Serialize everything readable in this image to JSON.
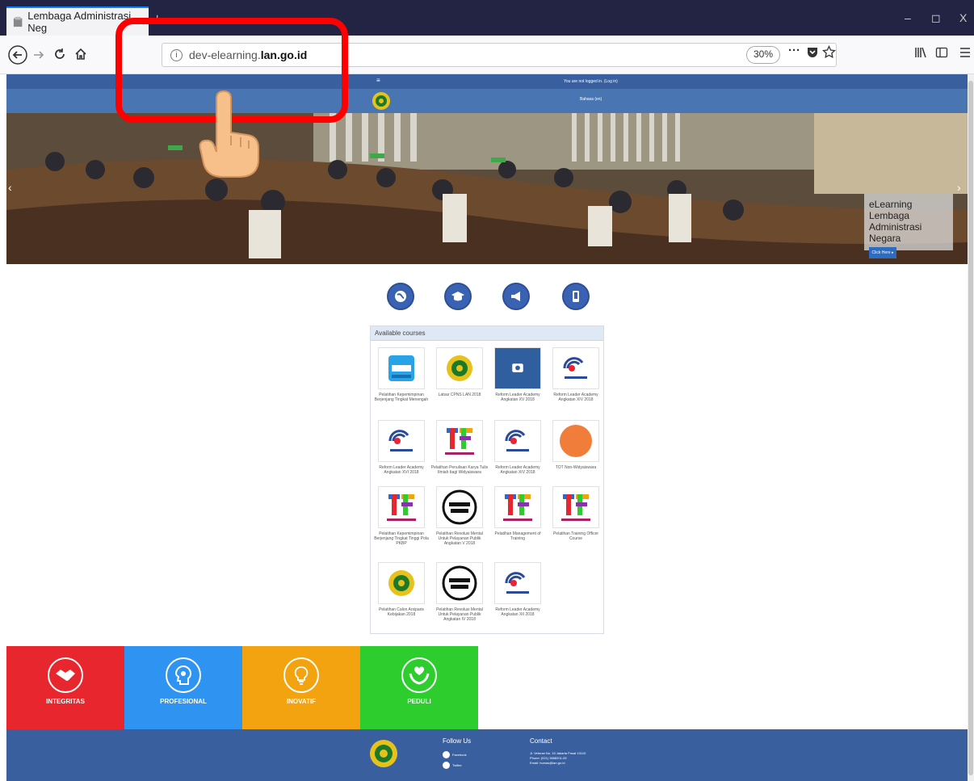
{
  "browser": {
    "tab_title": "Lembaga Administrasi Neg",
    "tab_close": "×",
    "new_tab": "+",
    "url_prefix": "dev-elearning.",
    "url_domain": "lan.go.id",
    "zoom": "30%",
    "window": {
      "minimize": "–",
      "restore": "◻",
      "close": "X"
    }
  },
  "site": {
    "topbar_menu": "≡",
    "topbar_text": "You are not logged in. (Log in)",
    "subbar_text": "Bahasa (en)",
    "hero": {
      "caption": "eLearning Lembaga Administrasi Negara",
      "caption_button": "Click Here ▸",
      "prev": "‹",
      "next": "›"
    },
    "courses": {
      "header": "Available courses",
      "items": [
        {
          "name": "Pelatihan Kepemimpinan Berjenjang Tingkat Menengah",
          "logo": "tab-app"
        },
        {
          "name": "Latsar CPNS LAN 2018",
          "logo": "garuda"
        },
        {
          "name": "Reform Leader Academy Angkatan XV 2018",
          "logo": "camera"
        },
        {
          "name": "Reform Leader Academy Angkatan XIV 2018",
          "logo": "rla"
        },
        {
          "name": "Reform Leader Academy Angkatan XVI 2018",
          "logo": "rla"
        },
        {
          "name": "Pelatihan Penulisan Karya Tulis Ilmiah bagi Widyaiswara",
          "logo": "tf"
        },
        {
          "name": "Reform Leader Academy Angkatan XIV 2018",
          "logo": "rla"
        },
        {
          "name": "TOT Non-Widyaiswara",
          "logo": "tot"
        },
        {
          "name": "Pelatihan Kepemimpinan Berjenjang Tingkat Tinggi Pola PKBP",
          "logo": "tf"
        },
        {
          "name": "Pelatihan Revolusi Mental Untuk Pelayanan Publik Angkatan V 2018",
          "logo": "revolusi"
        },
        {
          "name": "Pelatihan Management of Training",
          "logo": "tf"
        },
        {
          "name": "Pelatihan Training Officer Course",
          "logo": "tf"
        },
        {
          "name": "Pelatihan Calon Arsiparis Kebijakan 2018",
          "logo": "garuda"
        },
        {
          "name": "Pelatihan Revolusi Mental Untuk Pelayanan Publik Angkatan IV 2018",
          "logo": "revolusi"
        },
        {
          "name": "Reform Leader Academy Angkatan XII 2018",
          "logo": "rla"
        }
      ]
    },
    "values": [
      {
        "label": "INTEGRITAS",
        "color": "#e8262d",
        "icon": "handshake-icon"
      },
      {
        "label": "PROFESIONAL",
        "color": "#2f93f2",
        "icon": "head-icon"
      },
      {
        "label": "INOVATIF",
        "color": "#f3a30f",
        "icon": "lightbulb-icon"
      },
      {
        "label": "PEDULI",
        "color": "#2ecd2e",
        "icon": "heart-hands-icon"
      }
    ],
    "footer": {
      "follow_title": "Follow Us",
      "facebook": "Facebook",
      "twitter": "Twitter",
      "contact_title": "Contact",
      "address": "Jl. Veteran No. 10 Jakarta Pusat 10110",
      "phone": "Phone: (021) 3868201-05",
      "email": "Email: humas@lan.go.id"
    }
  },
  "annotation": {
    "color": "#ff0000",
    "pointer": "hand-pointer"
  }
}
